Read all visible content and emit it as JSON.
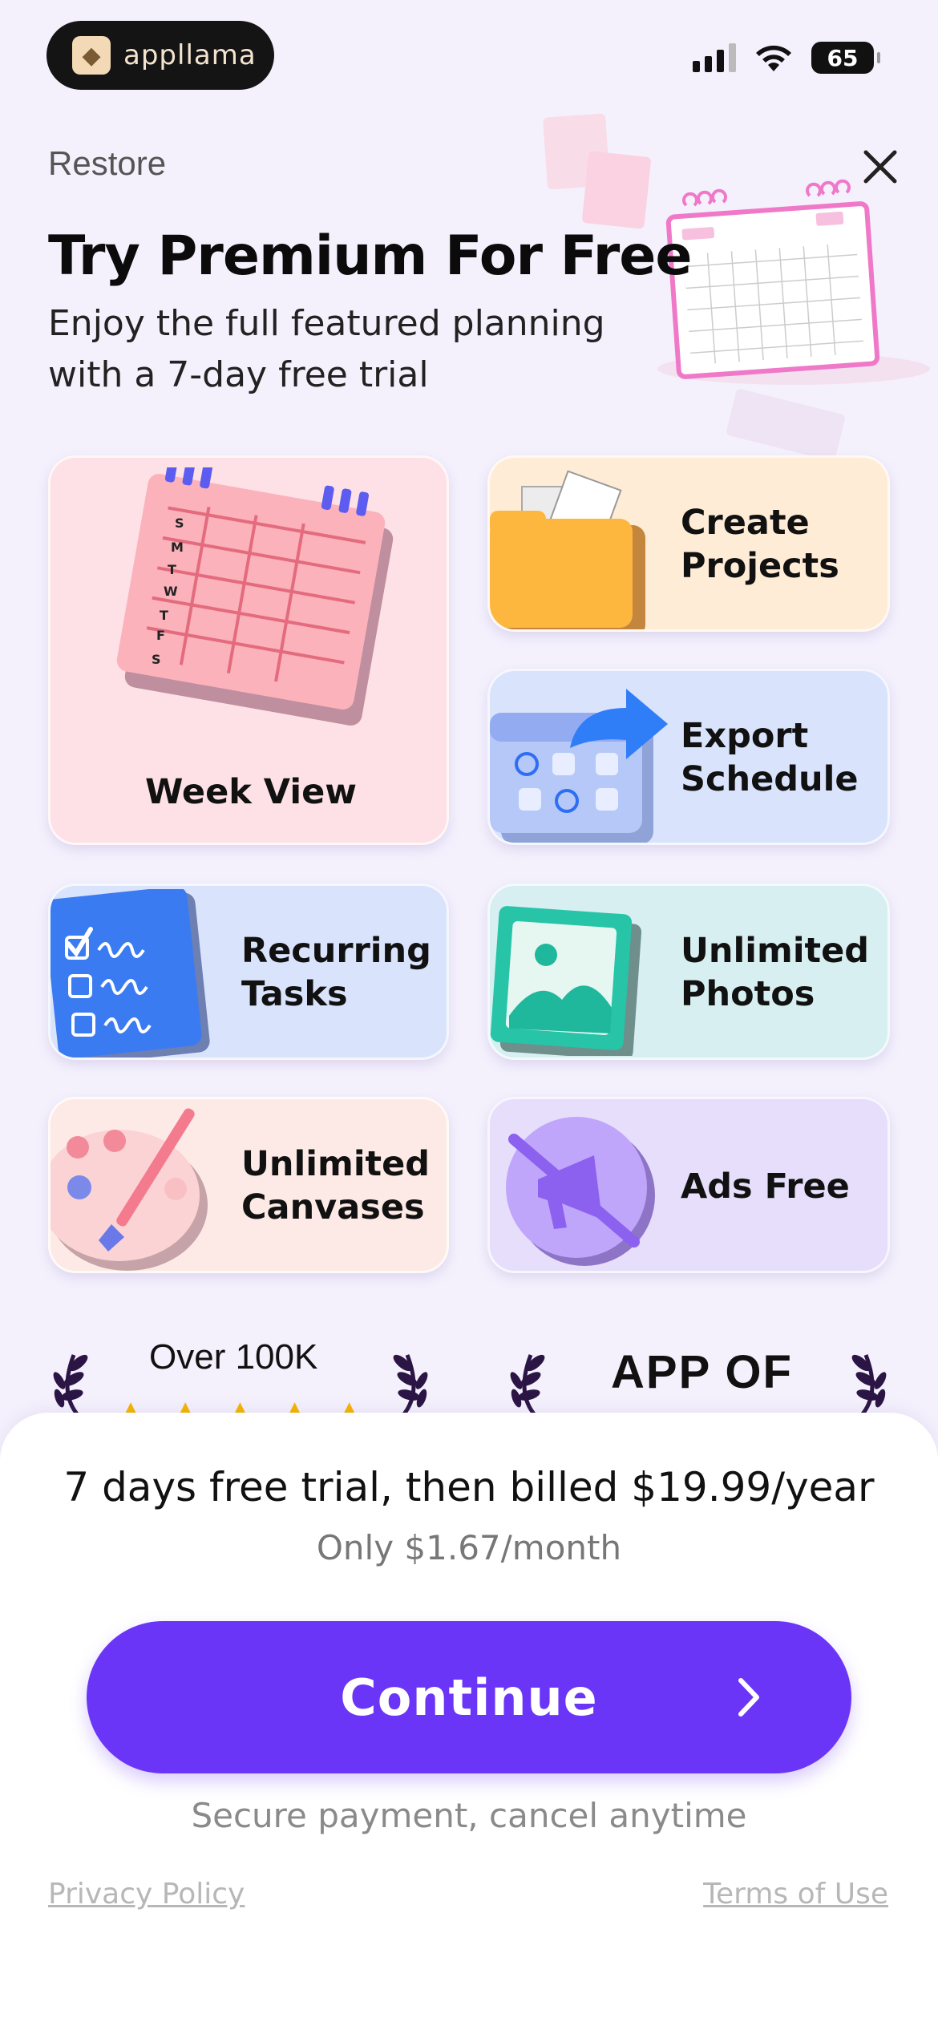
{
  "status_bar": {
    "app_name": "appllama",
    "battery": "65",
    "icons": [
      "signal-icon",
      "wifi-icon",
      "battery-icon"
    ]
  },
  "header": {
    "restore": "Restore",
    "title": "Try Premium For Free",
    "subtitle": "Enjoy the full featured planning with a 7-day free trial",
    "close_icon": "close-icon"
  },
  "features": [
    {
      "label": "Week View",
      "icon": "weekly-calendar-icon",
      "bg": "#fde1e6"
    },
    {
      "label": "Create Projects",
      "icon": "folder-icon",
      "bg": "#feecd6"
    },
    {
      "label": "Export Schedule",
      "icon": "export-arrow-icon",
      "bg": "#d9e3fc"
    },
    {
      "label": "Recurring Tasks",
      "icon": "checklist-icon",
      "bg": "#d9e3fc"
    },
    {
      "label": "Unlimited Photos",
      "icon": "photo-icon",
      "bg": "#d7eff0"
    },
    {
      "label": "Unlimited Canvases",
      "icon": "palette-icon",
      "bg": "#fdeae6"
    },
    {
      "label": "Ads Free",
      "icon": "no-ads-icon",
      "bg": "#e6defb"
    }
  ],
  "social_proof": {
    "rating_text": "Over 100K",
    "award_text": "APP OF"
  },
  "purchase": {
    "trial_text": "7 days free trial, then billed $19.99/year",
    "price_text": "Only $1.67/month",
    "continue_label": "Continue",
    "secure_text": "Secure payment, cancel anytime",
    "privacy_link": "Privacy Policy",
    "terms_link": "Terms of Use"
  },
  "colors": {
    "accent": "#6a35f6",
    "background": "#f4f1fd"
  }
}
